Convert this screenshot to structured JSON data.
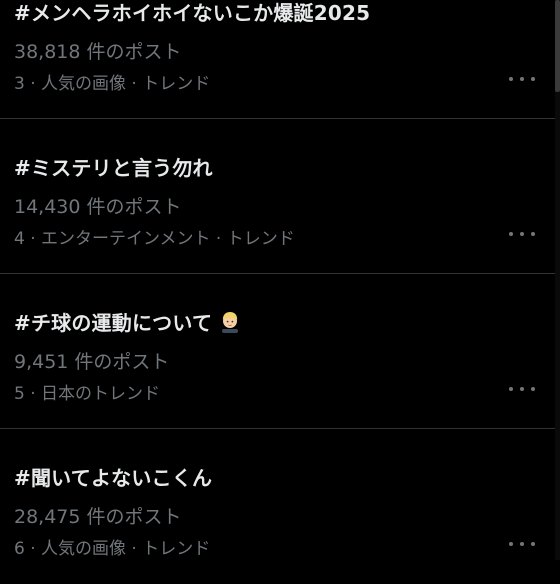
{
  "trends": [
    {
      "name": "#メンヘラホイホイないこか爆誕2025",
      "count": "38,818 件のポスト",
      "meta": "3 · 人気の画像 · トレンド",
      "emoji": false
    },
    {
      "name": "#ミステリと言う勿れ",
      "count": "14,430 件のポスト",
      "meta": "4 · エンターテインメント · トレンド",
      "emoji": false
    },
    {
      "name": "#チ球の運動について",
      "count": "9,451 件のポスト",
      "meta": "5 · 日本のトレンド",
      "emoji": true,
      "emoji_icon": "blond-person-emoji"
    },
    {
      "name": "#聞いてよないこくん",
      "count": "28,475 件のポスト",
      "meta": "6 · 人気の画像 · トレンド",
      "emoji": false
    }
  ],
  "more_icon": "more-horizontal-icon",
  "colors": {
    "background": "#000000",
    "primary_text": "#e7e9ea",
    "secondary_text": "#71767b",
    "divider": "#2f3336"
  }
}
